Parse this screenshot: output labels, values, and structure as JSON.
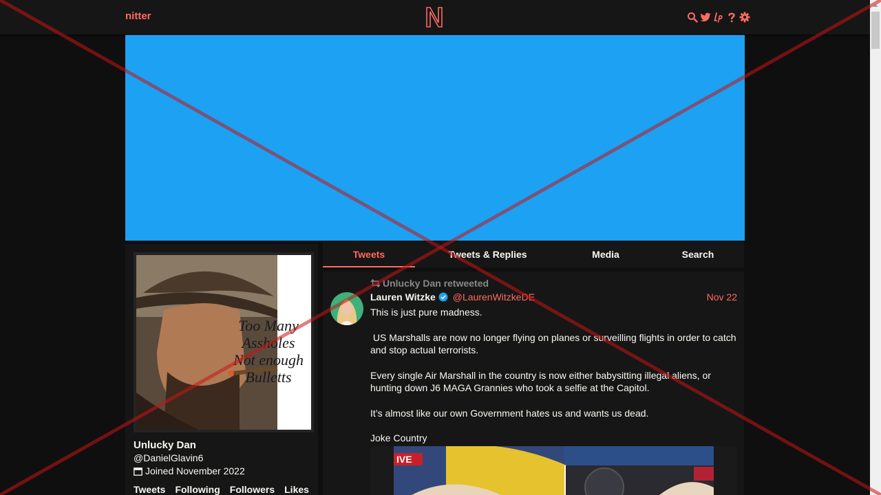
{
  "nav": {
    "brand": "nitter",
    "icons": [
      "search-icon",
      "twitter-icon",
      "lp-icon",
      "help-icon",
      "gear-icon"
    ]
  },
  "colors": {
    "accent": "#ff6c60",
    "banner": "#1da1f2",
    "background": "#0f0f0f",
    "panel": "#161616",
    "muted": "#888889"
  },
  "profile": {
    "avatar_text": [
      "Too Many",
      "Assholes",
      "Not enough",
      "Bulletts"
    ],
    "name": "Unlucky Dan",
    "handle": "@DanielGlavin6",
    "joined": "Joined November 2022",
    "stats": [
      "Tweets",
      "Following",
      "Followers",
      "Likes"
    ]
  },
  "tabs": [
    "Tweets",
    "Tweets & Replies",
    "Media",
    "Search"
  ],
  "tweet": {
    "retweet_label": "Unlucky Dan retweeted",
    "fullname": "Lauren Witzke",
    "username": "@LaurenWitzkeDE",
    "date": "Nov 22",
    "paragraphs": [
      "This is just pure madness.",
      " US Marshalls are now no longer flying on planes or surveilling flights in order to catch and stop actual terrorists.",
      "Every single Air Marshall in the country is now either babysitting illegal aliens, or hunting down J6 MAGA Grannies who took a selfie at the Capitol.",
      "It’s almost like our own Government hates us and wants us dead.",
      "Joke Country"
    ],
    "media_badge": "IVE"
  }
}
